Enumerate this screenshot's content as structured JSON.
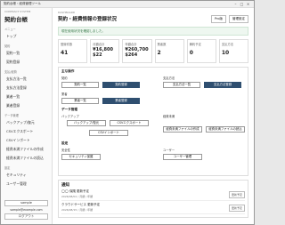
{
  "window": {
    "title": "契約台帳・経費管理ツール"
  },
  "sidebar": {
    "brand_sub": "CONTRACT SYSTEM",
    "brand": "契約台帳",
    "menu_label": "メニュー",
    "top": "トップ",
    "sections": [
      {
        "label": "契約",
        "items": [
          "契約一覧",
          "契約登録"
        ]
      },
      {
        "label": "支払/経費",
        "items": [
          "支払方法一覧",
          "支払方法登録",
          "業者一覧",
          "業者登録"
        ]
      },
      {
        "label": "データ管理",
        "items": [
          "バックアップ/復元",
          "CSVエクスポート",
          "CSVインポート",
          "経費未満ファイルの作成",
          "経費未満ファイルの読込"
        ]
      },
      {
        "label": "設定",
        "items": [
          "セキュリティ",
          "ユーザー管理"
        ]
      }
    ],
    "user_name": "sample",
    "user_email": "sample@example.com",
    "logout": "ログアウト"
  },
  "header": {
    "sub": "DASHBOARD",
    "title": "契約・経費情報の登録状況",
    "pro_label": "Pro版",
    "settings_label": "管理設定"
  },
  "alert": "現在使用状況を確認しました。",
  "stats": [
    {
      "label": "登録件数",
      "value": "41"
    },
    {
      "label": "月額合計",
      "value": "¥16,800\n$22"
    },
    {
      "label": "年額合計",
      "value": "¥260,700\n$264"
    },
    {
      "label": "業者数",
      "value": "2"
    },
    {
      "label": "解約予定",
      "value": "0"
    },
    {
      "label": "支払方法",
      "value": "10"
    }
  ],
  "ops": {
    "title": "主な操作",
    "contract": {
      "label": "契約",
      "list": "契約一覧",
      "register": "契約登録"
    },
    "payment": {
      "label": "支払方法",
      "list": "支払方法一覧",
      "register": "支払方法登録"
    },
    "vendor": {
      "label": "業者",
      "list": "業者一覧",
      "register": "業者登録"
    },
    "data_title": "データ管理",
    "backup": {
      "label": "バックアップ",
      "backup": "バックアップ/復元",
      "csv_export": "CSVエクスポート",
      "csv_import": "CSVインポート"
    },
    "expense": {
      "label": "経費未満",
      "create": "経費未満ファイルの作成",
      "load": "経費未満ファイルの読込"
    },
    "settings_title": "設定",
    "security": {
      "label": "安全性",
      "button": "セキュリティ保護"
    },
    "users": {
      "label": "ユーザー",
      "button": "ユーザー管理"
    }
  },
  "notices": {
    "title": "通知",
    "items": [
      {
        "title": "◯◯ 保険 更新予定",
        "date": "2026/08/01 / 月額 / 年額",
        "badge": "更新予定"
      },
      {
        "title": "クラウドサービス 更新予定",
        "date": "2026/08/15 / 月額 / 年額",
        "badge": "更新予定"
      }
    ]
  }
}
